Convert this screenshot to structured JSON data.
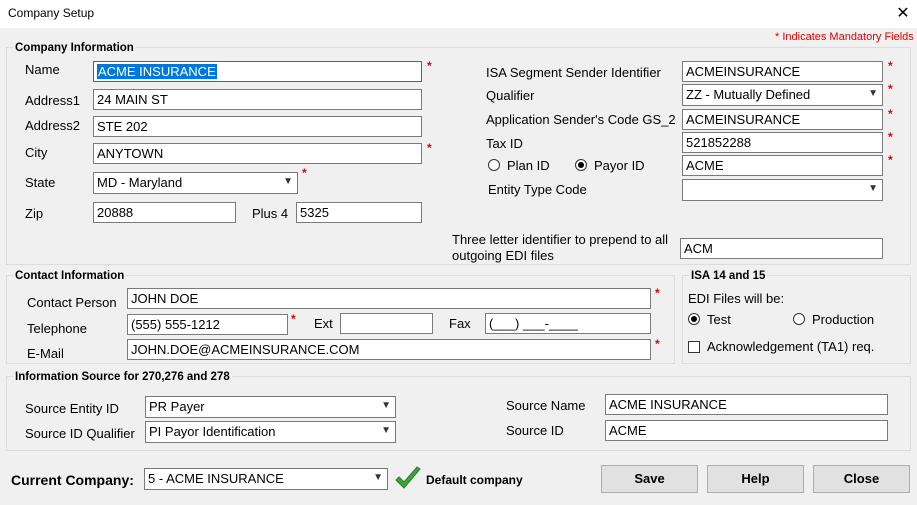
{
  "window": {
    "title": "Company Setup",
    "close_glyph": "✕"
  },
  "mandatory_note": "* Indicates Mandatory Fields",
  "star": "*",
  "company_info": {
    "title": "Company Information",
    "name_label": "Name",
    "name_value": "ACME INSURANCE",
    "address1_label": "Address1",
    "address1_value": "24 MAIN ST",
    "address2_label": "Address2",
    "address2_value": "STE 202",
    "city_label": "City",
    "city_value": "ANYTOWN",
    "state_label": "State",
    "state_value": "MD - Maryland",
    "zip_label": "Zip",
    "zip_value": "20888",
    "plus4_label": "Plus 4",
    "plus4_value": "5325",
    "isa_sender_label": "ISA Segment Sender Identifier",
    "isa_sender_value": "ACMEINSURANCE",
    "qualifier_label": "Qualifier",
    "qualifier_value": "ZZ - Mutually Defined",
    "gs2_label": "Application Sender's Code GS_2",
    "gs2_value": "ACMEINSURANCE",
    "taxid_label": "Tax ID",
    "taxid_value": "521852288",
    "plan_id_label": "Plan ID",
    "payor_id_label": "Payor ID",
    "payor_value": "ACME",
    "entity_type_label": "Entity Type Code",
    "entity_type_value": "",
    "prefix_label_line1": "Three letter identifier to prepend to all",
    "prefix_label_line2": "outgoing EDI files",
    "prefix_value": "ACM"
  },
  "contact_info": {
    "title": "Contact Information",
    "person_label": "Contact Person",
    "person_value": "JOHN DOE",
    "telephone_label": "Telephone",
    "telephone_value": "(555) 555-1212",
    "ext_label": "Ext",
    "ext_value": "",
    "fax_label": "Fax",
    "fax_value": "(___) ___-____",
    "email_label": "E-Mail",
    "email_value": "JOHN.DOE@ACMEINSURANCE.COM"
  },
  "isa_14_15": {
    "title": "ISA 14 and 15",
    "edi_label": "EDI Files will be:",
    "test_label": "Test",
    "production_label": "Production",
    "ack_label": "Acknowledgement (TA1) req."
  },
  "info_source": {
    "title": "Information Source for 270,276 and 278",
    "entity_label": "Source Entity ID",
    "entity_value": "PR Payer",
    "qualifier_label": "Source ID Qualifier",
    "qualifier_value": "PI Payor Identification",
    "name_label": "Source Name",
    "name_value": "ACME INSURANCE",
    "id_label": "Source ID",
    "id_value": "ACME"
  },
  "footer": {
    "current_company_label": "Current Company:",
    "current_company_value": "5 - ACME INSURANCE",
    "default_label": "Default company",
    "save": "Save",
    "help": "Help",
    "close": "Close"
  },
  "icons": {
    "dropdown": "chevron-down-icon",
    "check": "checkmark-icon"
  },
  "colors": {
    "mandatory": "#e00000",
    "selection": "#0078d7",
    "check_green": "#3aa53a"
  }
}
